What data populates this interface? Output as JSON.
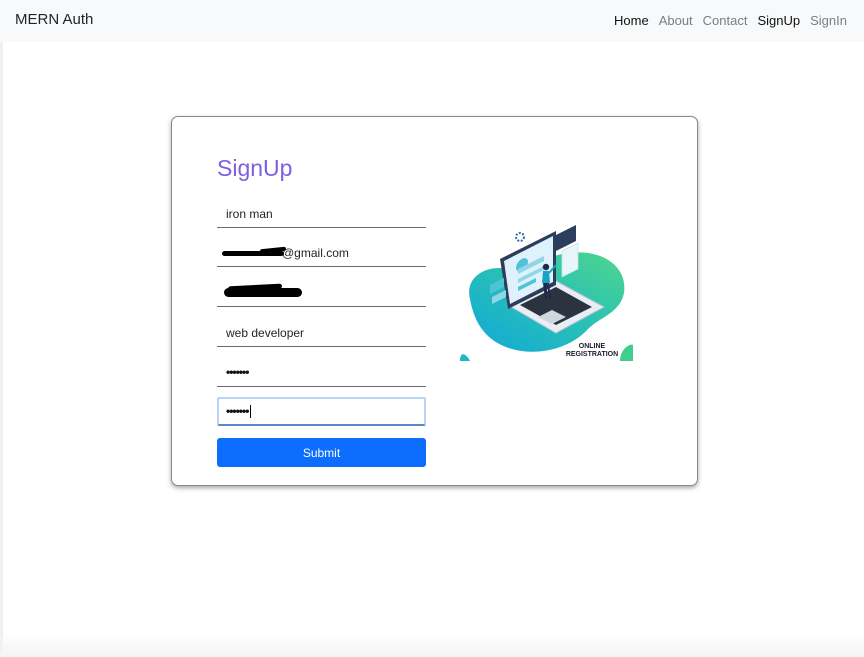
{
  "navbar": {
    "brand": "MERN Auth",
    "links": [
      {
        "label": "Home",
        "active": true
      },
      {
        "label": "About",
        "active": false
      },
      {
        "label": "Contact",
        "active": false
      },
      {
        "label": "SignUp",
        "active": true
      },
      {
        "label": "SignIn",
        "active": false
      }
    ]
  },
  "form": {
    "title": "SignUp",
    "fields": {
      "name": {
        "value": "iron man"
      },
      "email": {
        "value": "ironman12@gmail.com",
        "visible_suffix": "@gmail.com"
      },
      "phone": {
        "value": ""
      },
      "work": {
        "value": "web developer"
      },
      "password": {
        "value": "•••••••"
      },
      "confirm_password": {
        "value": "•••••••"
      }
    },
    "submit_label": "Submit"
  },
  "illustration": {
    "caption_line1": "ONLINE",
    "caption_line2": "REGISTRATION"
  },
  "colors": {
    "title": "#7b61e0",
    "button": "#0d6efd",
    "navbar_bg": "#f8f9fa",
    "illustration_teal": "#1fb6c9",
    "illustration_green": "#3ecf8e"
  }
}
